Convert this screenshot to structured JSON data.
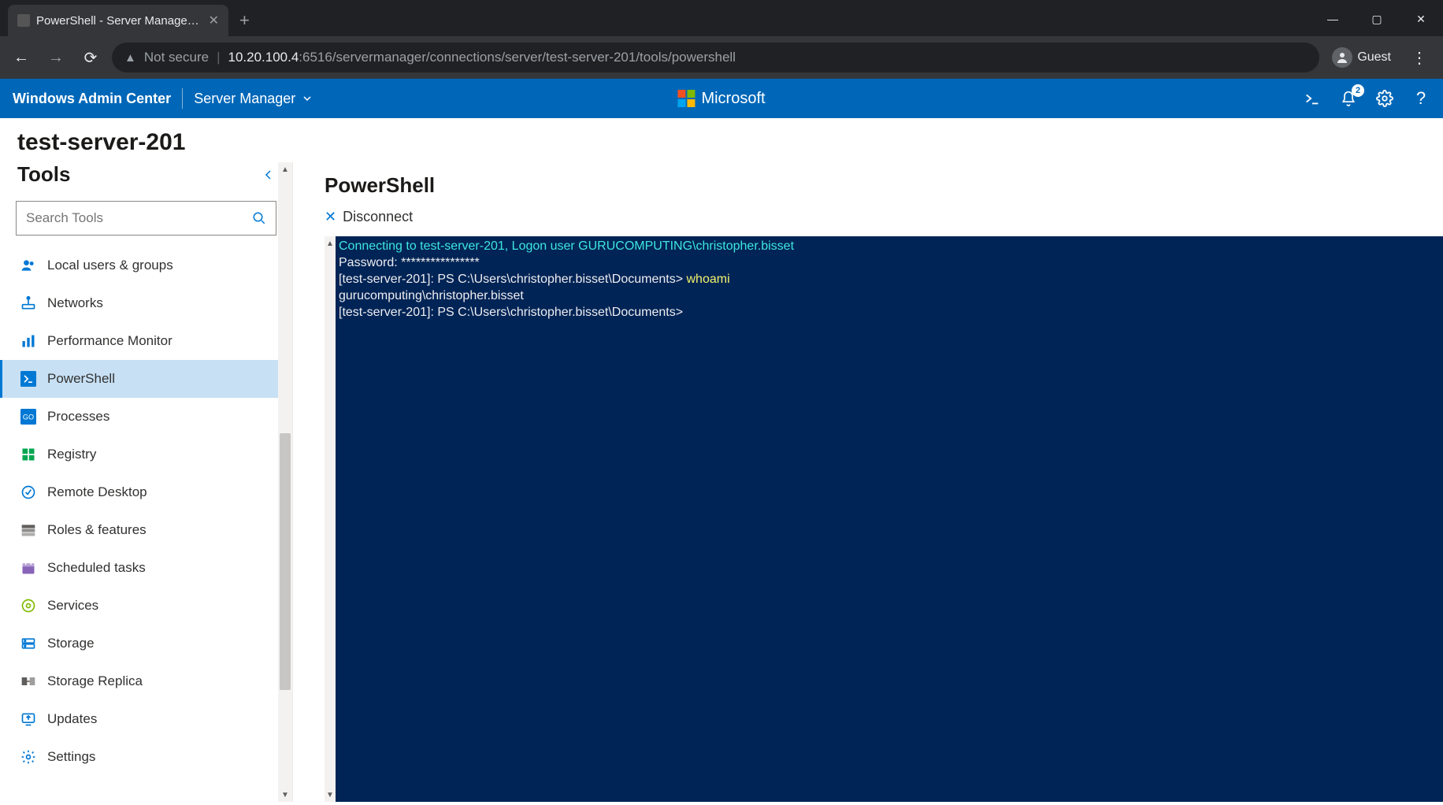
{
  "browser": {
    "tab_title": "PowerShell - Server Manager - W",
    "not_secure": "Not secure",
    "url_host": "10.20.100.4",
    "url_port_path": ":6516/servermanager/connections/server/test-server-201/tools/powershell",
    "profile_label": "Guest"
  },
  "wac": {
    "brand": "Windows Admin Center",
    "context": "Server Manager",
    "ms_label": "Microsoft",
    "notif_count": "2"
  },
  "server_name": "test-server-201",
  "sidebar": {
    "title": "Tools",
    "search_placeholder": "Search Tools",
    "items": [
      {
        "label": "Local users & groups",
        "icon": "users",
        "color": "#0078d4"
      },
      {
        "label": "Networks",
        "icon": "network",
        "color": "#0078d4"
      },
      {
        "label": "Performance Monitor",
        "icon": "chart",
        "color": "#0078d4"
      },
      {
        "label": "PowerShell",
        "icon": "ps",
        "color": "#0078d4",
        "active": true
      },
      {
        "label": "Processes",
        "icon": "proc",
        "color": "#0078d4"
      },
      {
        "label": "Registry",
        "icon": "reg",
        "color": "#00a650"
      },
      {
        "label": "Remote Desktop",
        "icon": "rdp",
        "color": "#0078d4"
      },
      {
        "label": "Roles & features",
        "icon": "roles",
        "color": "#605e5c"
      },
      {
        "label": "Scheduled tasks",
        "icon": "sched",
        "color": "#8764b8"
      },
      {
        "label": "Services",
        "icon": "svc",
        "color": "#7fba00"
      },
      {
        "label": "Storage",
        "icon": "storage",
        "color": "#0078d4"
      },
      {
        "label": "Storage Replica",
        "icon": "replica",
        "color": "#605e5c"
      },
      {
        "label": "Updates",
        "icon": "updates",
        "color": "#0078d4"
      },
      {
        "label": "Settings",
        "icon": "gear",
        "color": "#0078d4"
      }
    ]
  },
  "content": {
    "title": "PowerShell",
    "disconnect_label": "Disconnect"
  },
  "terminal": {
    "line1": "Connecting to test-server-201, Logon user GURUCOMPUTING\\christopher.bisset",
    "line2_label": "Password: ",
    "line2_mask": "****************",
    "line3_prompt": "[test-server-201]: PS C:\\Users\\christopher.bisset\\Documents> ",
    "line3_cmd": "whoami",
    "line4": "gurucomputing\\christopher.bisset",
    "line5": "[test-server-201]: PS C:\\Users\\christopher.bisset\\Documents>"
  }
}
